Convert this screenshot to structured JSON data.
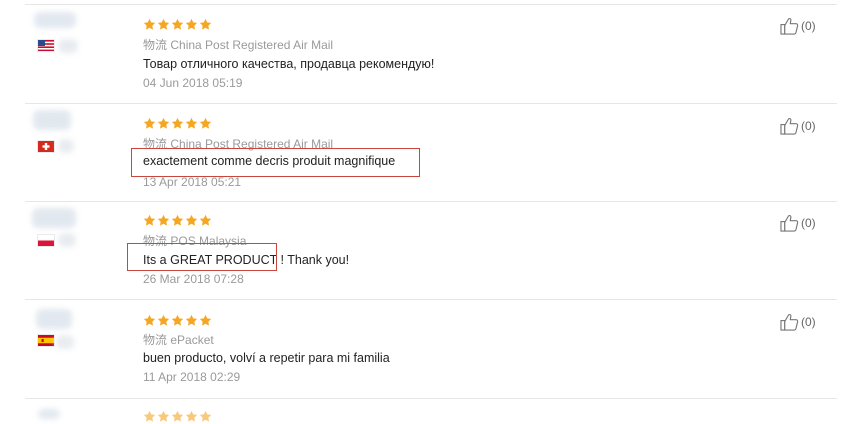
{
  "colors": {
    "star": "#f5a623",
    "highlight": "#c8463e",
    "meta": "#9a9a9a",
    "divider": "#e6e6e6"
  },
  "reviews": [
    {
      "flag": "us-flag-icon",
      "rating": 5,
      "logistics_label": "物流",
      "logistics": "China Post Registered Air Mail",
      "comment": "Товар отличного качества, продавца рекомендую!",
      "date": "04 Jun 2018 05:19",
      "helpful": "(0)",
      "highlighted": false
    },
    {
      "flag": "switzerland-flag-icon",
      "rating": 5,
      "logistics_label": "物流",
      "logistics": "China Post Registered Air Mail",
      "comment": "exactement comme decris produit magnifique",
      "date": "13 Apr 2018 05:21",
      "helpful": "(0)",
      "highlighted": true
    },
    {
      "flag": "poland-flag-icon",
      "rating": 5,
      "logistics_label": "物流",
      "logistics": "POS Malaysia",
      "comment": "Its a GREAT PRODUCT ! Thank you!",
      "date": "26 Mar 2018 07:28",
      "helpful": "(0)",
      "highlighted": true
    },
    {
      "flag": "spain-flag-icon",
      "rating": 5,
      "logistics_label": "物流",
      "logistics": "ePacket",
      "comment": "buen producto, volví a repetir para mi familia",
      "date": "11 Apr 2018 02:29",
      "helpful": "(0)",
      "highlighted": false
    }
  ]
}
